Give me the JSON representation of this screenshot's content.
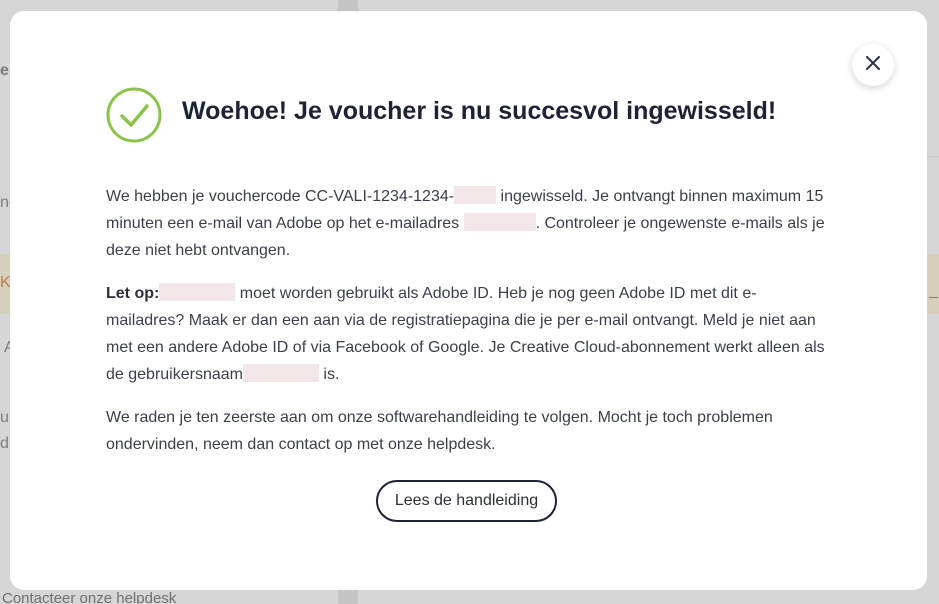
{
  "background": {
    "fragments": [
      "e",
      "ne",
      "K-",
      "A",
      "ub",
      "dr",
      "_"
    ],
    "bottom_link": "Contacteer onze helpdesk"
  },
  "modal": {
    "title": "Woehoe! Je voucher is nu succesvol ingewisseld!",
    "icons": {
      "success": "check-circle-icon",
      "close": "close-icon"
    },
    "colors": {
      "success_green": "#8bc34a",
      "title_dark": "#1d2235",
      "redaction": "#f3e6e9"
    },
    "paragraph1": {
      "part1": "We hebben je vouchercode CC-VALI-1234-1234-",
      "part2": "ingewisseld. Je ontvangt binnen maximum 15 minuten een e-mail van Adobe op het e-mailadres",
      "part3": ". Controleer je ongewenste e-mails als je deze niet hebt ontvangen."
    },
    "paragraph2": {
      "label": "Let op:",
      "part1": "moet worden gebruikt als Adobe ID. Heb je nog geen Adobe ID met dit e-mailadres? Maak er dan een aan via de registratiepagina die je per e-mail ontvangt. Meld je niet aan met een andere Adobe ID of via Facebook of Google. Je Creative Cloud-abonnement werkt alleen als de gebruikersnaam",
      "part2": "is."
    },
    "paragraph3": "We raden je ten zeerste aan om onze softwarehandleiding te volgen. Mocht je toch problemen ondervinden, neem dan contact op met onze helpdesk.",
    "button_label": "Lees de handleiding"
  }
}
